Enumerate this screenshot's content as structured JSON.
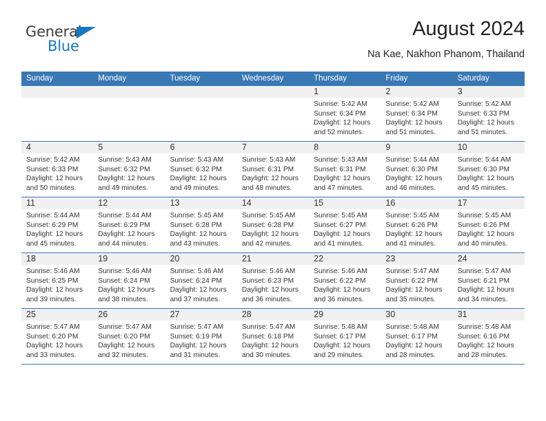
{
  "brand": {
    "name_part1": "General",
    "name_part2": "Blue",
    "triangle_color": "#1878be"
  },
  "header": {
    "title": "August 2024",
    "subtitle": "Na Kae, Nakhon Phanom, Thailand"
  },
  "theme": {
    "header_blue": "#3878b4",
    "daynum_band": "#f0f0f0",
    "text": "#333333"
  },
  "calendar": {
    "weekday_headers": [
      "Sunday",
      "Monday",
      "Tuesday",
      "Wednesday",
      "Thursday",
      "Friday",
      "Saturday"
    ],
    "weeks": [
      [
        {
          "day": "",
          "sunrise": "",
          "sunset": "",
          "daylight1": "",
          "daylight2": "",
          "empty": true
        },
        {
          "day": "",
          "sunrise": "",
          "sunset": "",
          "daylight1": "",
          "daylight2": "",
          "empty": true
        },
        {
          "day": "",
          "sunrise": "",
          "sunset": "",
          "daylight1": "",
          "daylight2": "",
          "empty": true
        },
        {
          "day": "",
          "sunrise": "",
          "sunset": "",
          "daylight1": "",
          "daylight2": "",
          "empty": true
        },
        {
          "day": "1",
          "sunrise": "Sunrise: 5:42 AM",
          "sunset": "Sunset: 6:34 PM",
          "daylight1": "Daylight: 12 hours",
          "daylight2": "and 52 minutes."
        },
        {
          "day": "2",
          "sunrise": "Sunrise: 5:42 AM",
          "sunset": "Sunset: 6:34 PM",
          "daylight1": "Daylight: 12 hours",
          "daylight2": "and 51 minutes."
        },
        {
          "day": "3",
          "sunrise": "Sunrise: 5:42 AM",
          "sunset": "Sunset: 6:33 PM",
          "daylight1": "Daylight: 12 hours",
          "daylight2": "and 51 minutes."
        }
      ],
      [
        {
          "day": "4",
          "sunrise": "Sunrise: 5:42 AM",
          "sunset": "Sunset: 6:33 PM",
          "daylight1": "Daylight: 12 hours",
          "daylight2": "and 50 minutes."
        },
        {
          "day": "5",
          "sunrise": "Sunrise: 5:43 AM",
          "sunset": "Sunset: 6:32 PM",
          "daylight1": "Daylight: 12 hours",
          "daylight2": "and 49 minutes."
        },
        {
          "day": "6",
          "sunrise": "Sunrise: 5:43 AM",
          "sunset": "Sunset: 6:32 PM",
          "daylight1": "Daylight: 12 hours",
          "daylight2": "and 49 minutes."
        },
        {
          "day": "7",
          "sunrise": "Sunrise: 5:43 AM",
          "sunset": "Sunset: 6:31 PM",
          "daylight1": "Daylight: 12 hours",
          "daylight2": "and 48 minutes."
        },
        {
          "day": "8",
          "sunrise": "Sunrise: 5:43 AM",
          "sunset": "Sunset: 6:31 PM",
          "daylight1": "Daylight: 12 hours",
          "daylight2": "and 47 minutes."
        },
        {
          "day": "9",
          "sunrise": "Sunrise: 5:44 AM",
          "sunset": "Sunset: 6:30 PM",
          "daylight1": "Daylight: 12 hours",
          "daylight2": "and 46 minutes."
        },
        {
          "day": "10",
          "sunrise": "Sunrise: 5:44 AM",
          "sunset": "Sunset: 6:30 PM",
          "daylight1": "Daylight: 12 hours",
          "daylight2": "and 45 minutes."
        }
      ],
      [
        {
          "day": "11",
          "sunrise": "Sunrise: 5:44 AM",
          "sunset": "Sunset: 6:29 PM",
          "daylight1": "Daylight: 12 hours",
          "daylight2": "and 45 minutes."
        },
        {
          "day": "12",
          "sunrise": "Sunrise: 5:44 AM",
          "sunset": "Sunset: 6:29 PM",
          "daylight1": "Daylight: 12 hours",
          "daylight2": "and 44 minutes."
        },
        {
          "day": "13",
          "sunrise": "Sunrise: 5:45 AM",
          "sunset": "Sunset: 6:28 PM",
          "daylight1": "Daylight: 12 hours",
          "daylight2": "and 43 minutes."
        },
        {
          "day": "14",
          "sunrise": "Sunrise: 5:45 AM",
          "sunset": "Sunset: 6:28 PM",
          "daylight1": "Daylight: 12 hours",
          "daylight2": "and 42 minutes."
        },
        {
          "day": "15",
          "sunrise": "Sunrise: 5:45 AM",
          "sunset": "Sunset: 6:27 PM",
          "daylight1": "Daylight: 12 hours",
          "daylight2": "and 41 minutes."
        },
        {
          "day": "16",
          "sunrise": "Sunrise: 5:45 AM",
          "sunset": "Sunset: 6:26 PM",
          "daylight1": "Daylight: 12 hours",
          "daylight2": "and 41 minutes."
        },
        {
          "day": "17",
          "sunrise": "Sunrise: 5:45 AM",
          "sunset": "Sunset: 6:26 PM",
          "daylight1": "Daylight: 12 hours",
          "daylight2": "and 40 minutes."
        }
      ],
      [
        {
          "day": "18",
          "sunrise": "Sunrise: 5:46 AM",
          "sunset": "Sunset: 6:25 PM",
          "daylight1": "Daylight: 12 hours",
          "daylight2": "and 39 minutes."
        },
        {
          "day": "19",
          "sunrise": "Sunrise: 5:46 AM",
          "sunset": "Sunset: 6:24 PM",
          "daylight1": "Daylight: 12 hours",
          "daylight2": "and 38 minutes."
        },
        {
          "day": "20",
          "sunrise": "Sunrise: 5:46 AM",
          "sunset": "Sunset: 6:24 PM",
          "daylight1": "Daylight: 12 hours",
          "daylight2": "and 37 minutes."
        },
        {
          "day": "21",
          "sunrise": "Sunrise: 5:46 AM",
          "sunset": "Sunset: 6:23 PM",
          "daylight1": "Daylight: 12 hours",
          "daylight2": "and 36 minutes."
        },
        {
          "day": "22",
          "sunrise": "Sunrise: 5:46 AM",
          "sunset": "Sunset: 6:22 PM",
          "daylight1": "Daylight: 12 hours",
          "daylight2": "and 36 minutes."
        },
        {
          "day": "23",
          "sunrise": "Sunrise: 5:47 AM",
          "sunset": "Sunset: 6:22 PM",
          "daylight1": "Daylight: 12 hours",
          "daylight2": "and 35 minutes."
        },
        {
          "day": "24",
          "sunrise": "Sunrise: 5:47 AM",
          "sunset": "Sunset: 6:21 PM",
          "daylight1": "Daylight: 12 hours",
          "daylight2": "and 34 minutes."
        }
      ],
      [
        {
          "day": "25",
          "sunrise": "Sunrise: 5:47 AM",
          "sunset": "Sunset: 6:20 PM",
          "daylight1": "Daylight: 12 hours",
          "daylight2": "and 33 minutes."
        },
        {
          "day": "26",
          "sunrise": "Sunrise: 5:47 AM",
          "sunset": "Sunset: 6:20 PM",
          "daylight1": "Daylight: 12 hours",
          "daylight2": "and 32 minutes."
        },
        {
          "day": "27",
          "sunrise": "Sunrise: 5:47 AM",
          "sunset": "Sunset: 6:19 PM",
          "daylight1": "Daylight: 12 hours",
          "daylight2": "and 31 minutes."
        },
        {
          "day": "28",
          "sunrise": "Sunrise: 5:47 AM",
          "sunset": "Sunset: 6:18 PM",
          "daylight1": "Daylight: 12 hours",
          "daylight2": "and 30 minutes."
        },
        {
          "day": "29",
          "sunrise": "Sunrise: 5:48 AM",
          "sunset": "Sunset: 6:17 PM",
          "daylight1": "Daylight: 12 hours",
          "daylight2": "and 29 minutes."
        },
        {
          "day": "30",
          "sunrise": "Sunrise: 5:48 AM",
          "sunset": "Sunset: 6:17 PM",
          "daylight1": "Daylight: 12 hours",
          "daylight2": "and 28 minutes."
        },
        {
          "day": "31",
          "sunrise": "Sunrise: 5:48 AM",
          "sunset": "Sunset: 6:16 PM",
          "daylight1": "Daylight: 12 hours",
          "daylight2": "and 28 minutes."
        }
      ]
    ]
  }
}
